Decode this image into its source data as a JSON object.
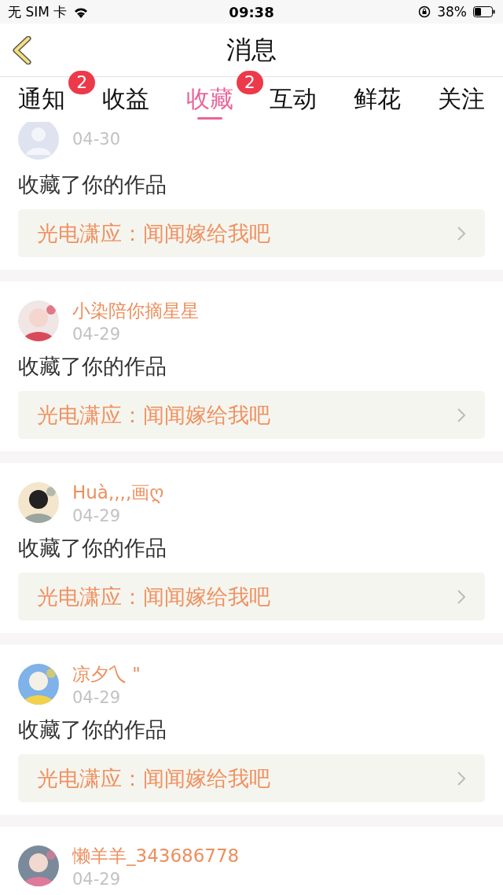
{
  "status_bar": {
    "carrier": "无 SIM 卡",
    "time": "09:38",
    "battery": "38%"
  },
  "header": {
    "title": "消息"
  },
  "tabs": [
    {
      "label": "通知",
      "selected": false,
      "badge": "2"
    },
    {
      "label": "收益",
      "selected": false
    },
    {
      "label": "收藏",
      "selected": true,
      "badge": "2"
    },
    {
      "label": "互动",
      "selected": false
    },
    {
      "label": "鲜花",
      "selected": false
    },
    {
      "label": "关注",
      "selected": false
    }
  ],
  "messages": [
    {
      "date": "04-30",
      "action": "收藏了你的作品",
      "work": "光电潇应：闻闻嫁给我吧"
    },
    {
      "name": "小染陪你摘星星",
      "date": "04-29",
      "action": "收藏了你的作品",
      "work": "光电潇应：闻闻嫁给我吧"
    },
    {
      "name": "Huà,,,,画ღ",
      "date": "04-29",
      "action": "收藏了你的作品",
      "work": "光电潇应：闻闻嫁给我吧"
    },
    {
      "name": "凉夕乀 \"",
      "date": "04-29",
      "action": "收藏了你的作品",
      "work": "光电潇应：闻闻嫁给我吧"
    },
    {
      "name": "懒羊羊_343686778",
      "date": "04-29"
    }
  ]
}
